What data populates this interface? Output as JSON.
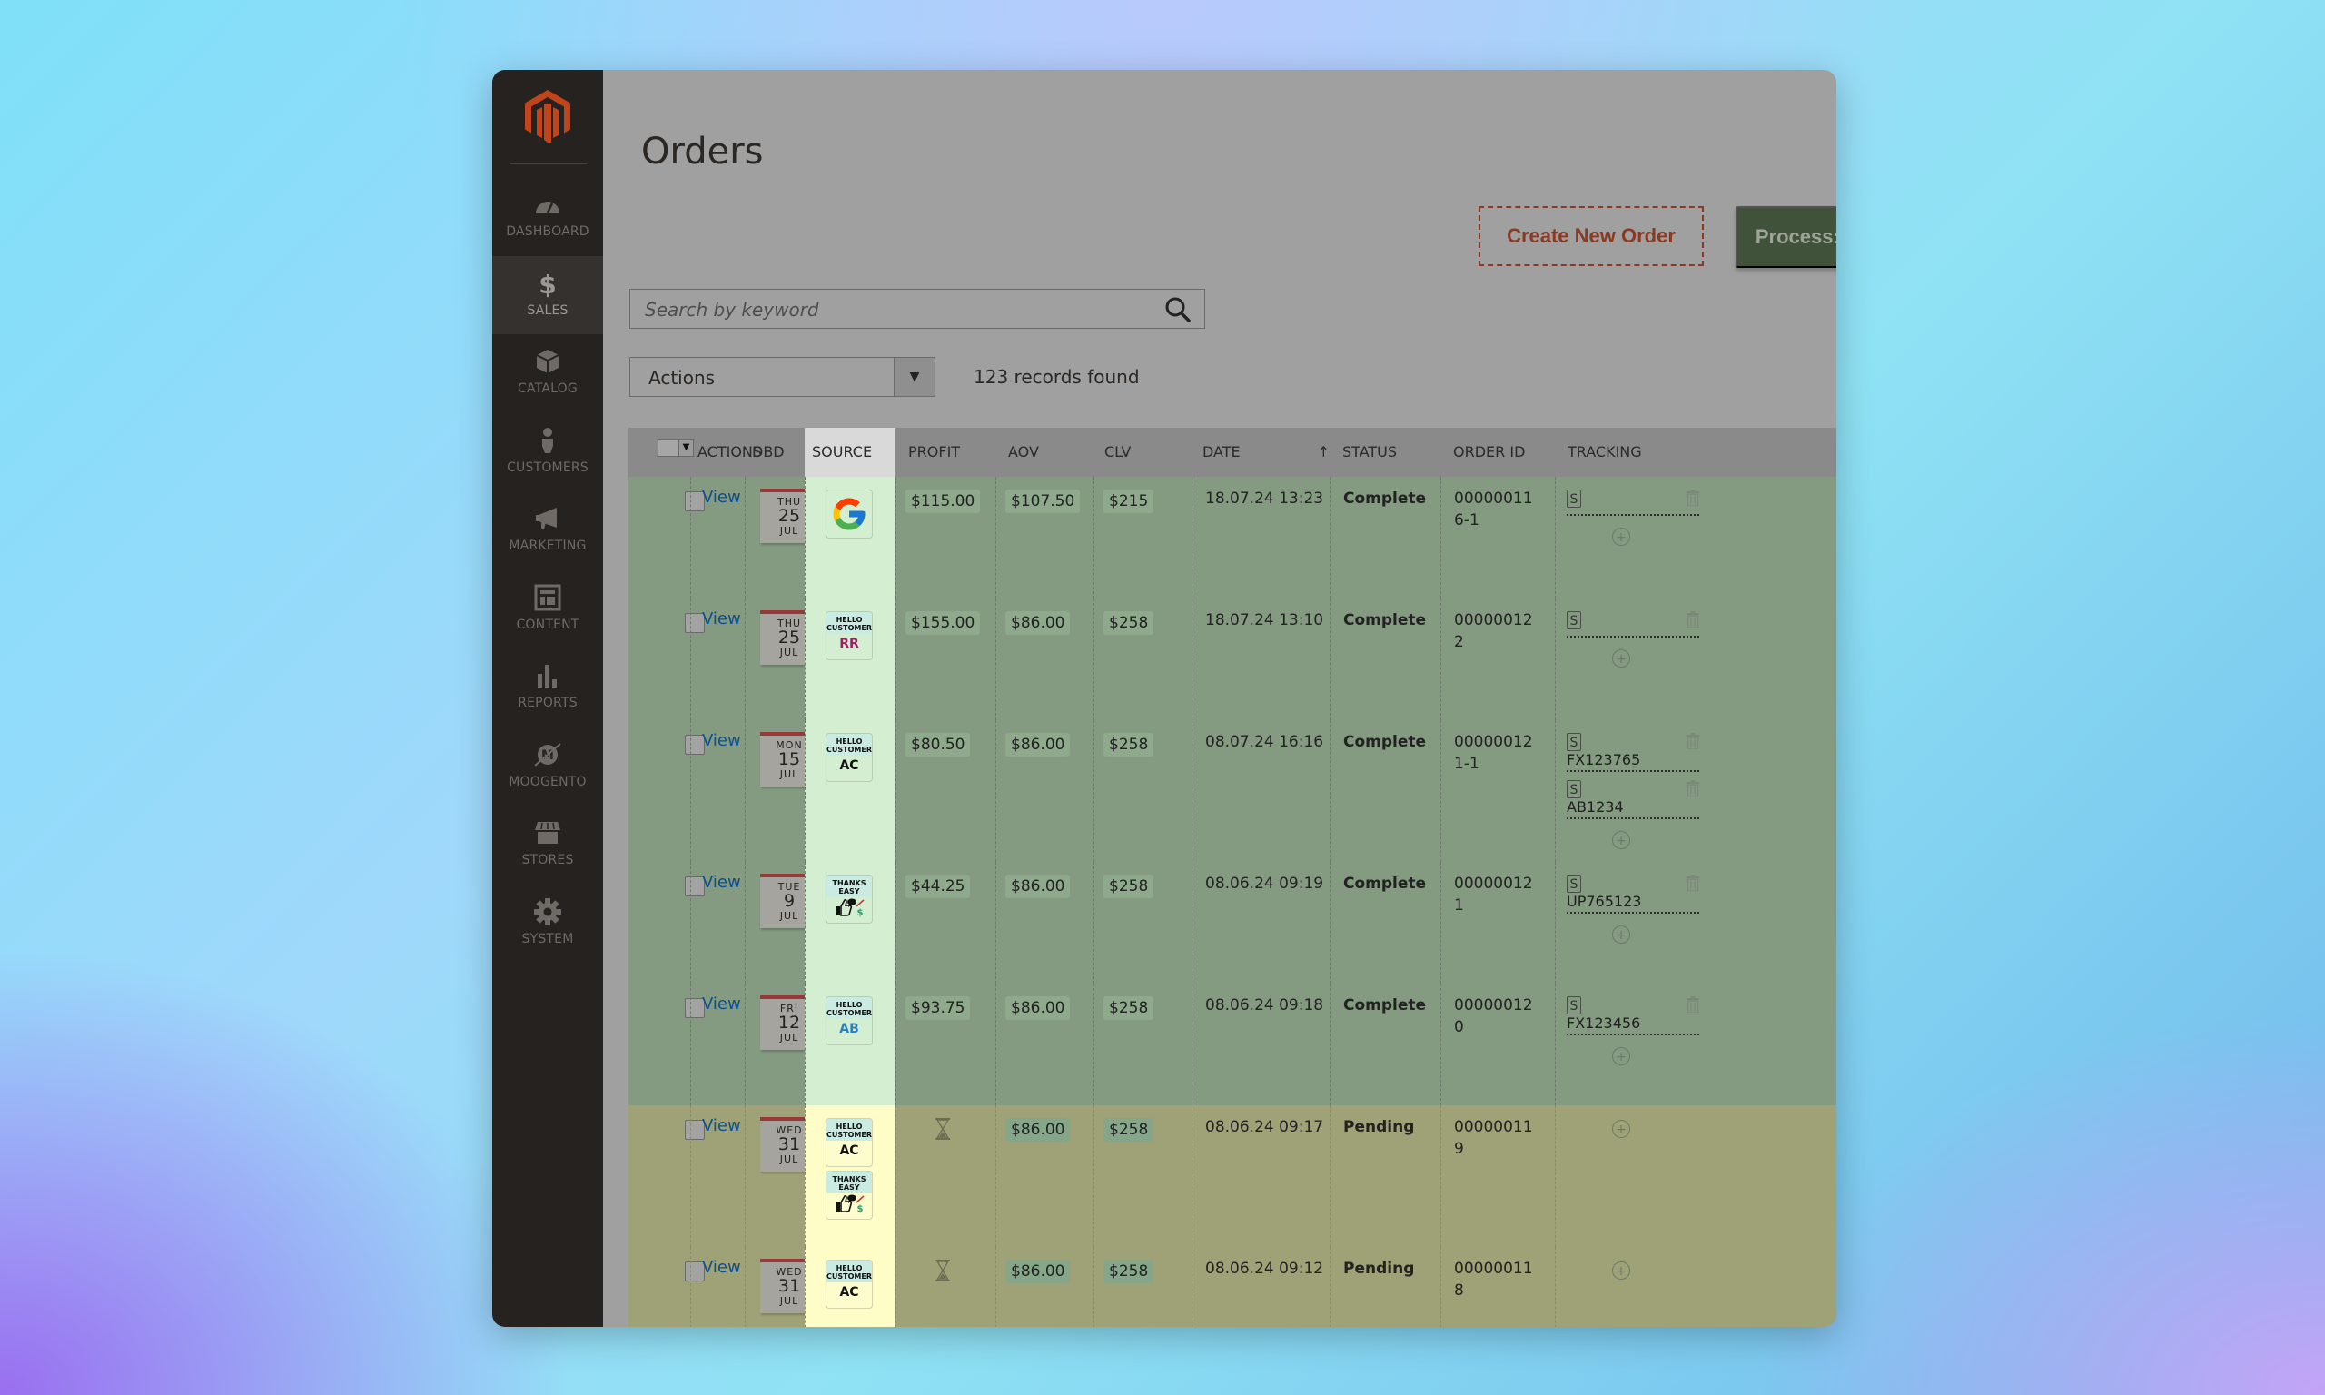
{
  "sidebar": {
    "logo": "magento-logo-icon",
    "items": [
      {
        "label": "DASHBOARD",
        "icon": "dashboard-gauge-icon"
      },
      {
        "label": "SALES",
        "icon": "dollar-icon",
        "active": true
      },
      {
        "label": "CATALOG",
        "icon": "box-icon"
      },
      {
        "label": "CUSTOMERS",
        "icon": "person-icon"
      },
      {
        "label": "MARKETING",
        "icon": "megaphone-icon"
      },
      {
        "label": "CONTENT",
        "icon": "layout-icon"
      },
      {
        "label": "REPORTS",
        "icon": "bar-chart-icon"
      },
      {
        "label": "MOOGENTO",
        "icon": "moogento-icon"
      },
      {
        "label": "STORES",
        "icon": "storefront-icon"
      },
      {
        "label": "SYSTEM",
        "icon": "gear-icon"
      }
    ]
  },
  "header": {
    "title": "Orders",
    "create_label": "Create New Order",
    "process_label": "Process: CSV"
  },
  "search": {
    "placeholder": "Search by keyword",
    "value": ""
  },
  "mass_actions": {
    "selected": "Actions"
  },
  "records_found": "123 records found",
  "grid": {
    "columns": [
      "ACTIONS",
      "DBD",
      "SOURCE",
      "PROFIT",
      "AOV",
      "CLV",
      "DATE",
      "STATUS",
      "ORDER ID",
      "TRACKING"
    ],
    "sort_indicator": "↑",
    "view_label": "View",
    "rows": [
      {
        "dbd": {
          "dow": "THU",
          "day": "25",
          "mon": "JUL"
        },
        "sources": [
          {
            "type": "google"
          }
        ],
        "profit": "$115.00",
        "aov": "$107.50",
        "clv": "$215",
        "date": "18.07.24 13:23",
        "status": "Complete",
        "status_type": "complete",
        "order_id": "000000116-1",
        "tracking": [
          {
            "carrier": "S",
            "number": ""
          }
        ]
      },
      {
        "dbd": {
          "dow": "THU",
          "day": "25",
          "mon": "JUL"
        },
        "sources": [
          {
            "type": "hello_customer",
            "top": "HELLO CUSTOMER",
            "code": "RR",
            "code_color": "#9b2066"
          }
        ],
        "profit": "$155.00",
        "aov": "$86.00",
        "clv": "$258",
        "date": "18.07.24 13:10",
        "status": "Complete",
        "status_type": "complete",
        "order_id": "000000122",
        "tracking": [
          {
            "carrier": "S",
            "number": ""
          }
        ]
      },
      {
        "dbd": {
          "dow": "MON",
          "day": "15",
          "mon": "JUL"
        },
        "sources": [
          {
            "type": "hello_customer",
            "top": "HELLO CUSTOMER",
            "code": "AC",
            "code_color": "#111111"
          }
        ],
        "profit": "$80.50",
        "aov": "$86.00",
        "clv": "$258",
        "date": "08.07.24 16:16",
        "status": "Complete",
        "status_type": "complete",
        "order_id": "000000121-1",
        "tracking": [
          {
            "carrier": "S",
            "number": "FX123765"
          },
          {
            "carrier": "S",
            "number": "AB1234"
          }
        ]
      },
      {
        "dbd": {
          "dow": "TUE",
          "day": "9",
          "mon": "JUL"
        },
        "sources": [
          {
            "type": "thanks_easy",
            "top": "THANKS EASY"
          }
        ],
        "profit": "$44.25",
        "aov": "$86.00",
        "clv": "$258",
        "date": "08.06.24 09:19",
        "status": "Complete",
        "status_type": "complete",
        "order_id": "000000121",
        "tracking": [
          {
            "carrier": "S",
            "number": "UP765123"
          }
        ]
      },
      {
        "dbd": {
          "dow": "FRI",
          "day": "12",
          "mon": "JUL"
        },
        "sources": [
          {
            "type": "hello_customer",
            "top": "HELLO CUSTOMER",
            "code": "AB",
            "code_color": "#2c7fb8"
          }
        ],
        "profit": "$93.75",
        "aov": "$86.00",
        "clv": "$258",
        "date": "08.06.24 09:18",
        "status": "Complete",
        "status_type": "complete",
        "order_id": "000000120",
        "tracking": [
          {
            "carrier": "S",
            "number": "FX123456"
          }
        ]
      },
      {
        "dbd": {
          "dow": "WED",
          "day": "31",
          "mon": "JUL"
        },
        "sources": [
          {
            "type": "hello_customer",
            "top": "HELLO CUSTOMER",
            "code": "AC",
            "code_color": "#111111"
          },
          {
            "type": "thanks_easy",
            "top": "THANKS EASY"
          }
        ],
        "profit": "",
        "profit_icon": "hourglass-icon",
        "aov": "$86.00",
        "clv": "$258",
        "date": "08.06.24 09:17",
        "status": "Pending",
        "status_type": "pending",
        "order_id": "000000119",
        "tracking": []
      },
      {
        "dbd": {
          "dow": "WED",
          "day": "31",
          "mon": "JUL"
        },
        "sources": [
          {
            "type": "hello_customer",
            "top": "HELLO CUSTOMER",
            "code": "AC",
            "code_color": "#111111"
          }
        ],
        "profit": "",
        "profit_icon": "hourglass-icon",
        "aov": "$86.00",
        "clv": "$258",
        "date": "08.06.24 09:12",
        "status": "Pending",
        "status_type": "pending",
        "order_id": "000000118",
        "tracking": []
      }
    ]
  },
  "colors": {
    "sidebar_bg": "#25221f",
    "brand_orange": "#c1441a",
    "complete_row": "#849a81",
    "pending_row": "#9fa276",
    "source_col_complete": "#d3eed0",
    "source_col_pending": "#fefdc8",
    "process_button": "#41523a",
    "create_button_text": "#8a3a22",
    "link": "#0c4f93"
  }
}
